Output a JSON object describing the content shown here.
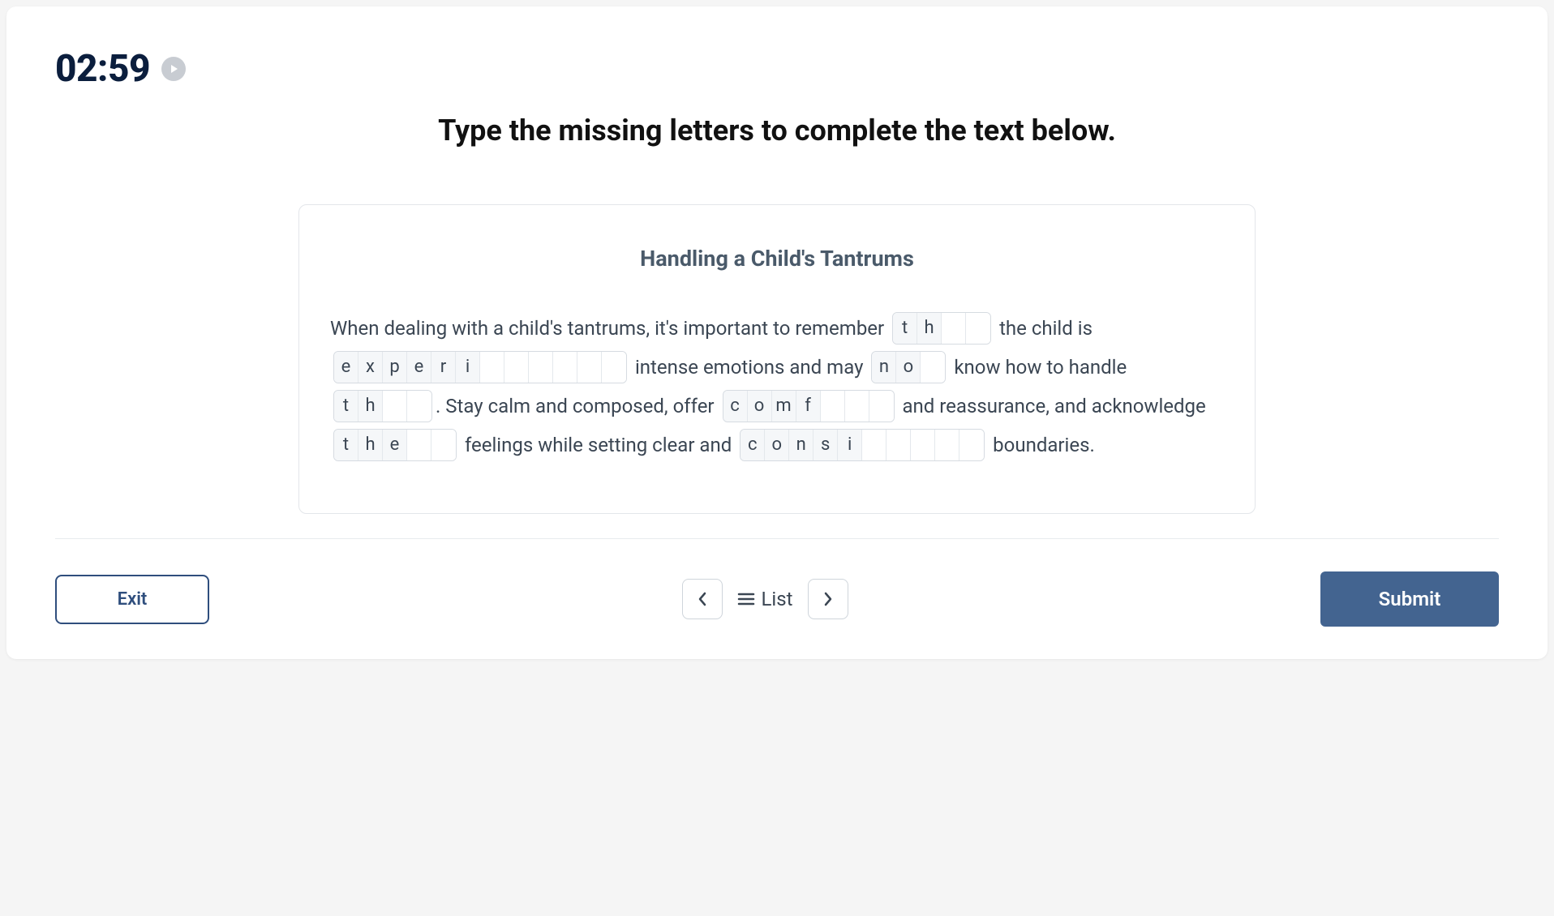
{
  "timer": "02:59",
  "instruction": "Type the missing letters to complete the text below.",
  "passage_title": "Handling a Child's Tantrums",
  "segments": [
    {
      "type": "text",
      "value": "When dealing with a child's tantrums, it's important to remember "
    },
    {
      "type": "blank",
      "given": [
        "t",
        "h"
      ],
      "empty": 2
    },
    {
      "type": "text",
      "value": " the child is "
    },
    {
      "type": "blank",
      "given": [
        "e",
        "x",
        "p",
        "e",
        "r",
        "i"
      ],
      "empty": 6
    },
    {
      "type": "text",
      "value": " intense emotions and may "
    },
    {
      "type": "blank",
      "given": [
        "n",
        "o"
      ],
      "empty": 1
    },
    {
      "type": "text",
      "value": " know how to handle "
    },
    {
      "type": "blank",
      "given": [
        "t",
        "h"
      ],
      "empty": 2
    },
    {
      "type": "text",
      "value": ".  Stay calm and composed, offer "
    },
    {
      "type": "blank",
      "given": [
        "c",
        "o",
        "m",
        "f"
      ],
      "empty": 3
    },
    {
      "type": "text",
      "value": " and reassurance, and acknowledge "
    },
    {
      "type": "blank",
      "given": [
        "t",
        "h",
        "e"
      ],
      "empty": 2
    },
    {
      "type": "text",
      "value": " feelings while setting clear and "
    },
    {
      "type": "blank",
      "given": [
        "c",
        "o",
        "n",
        "s",
        "i"
      ],
      "empty": 5
    },
    {
      "type": "text",
      "value": " boundaries."
    }
  ],
  "footer": {
    "exit": "Exit",
    "list": "List",
    "submit": "Submit"
  }
}
